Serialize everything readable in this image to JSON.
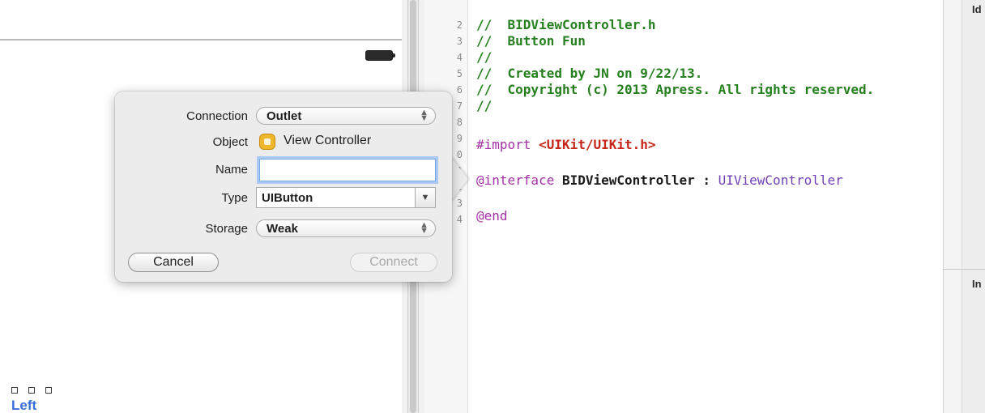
{
  "editor": {
    "line_numbers": [
      "2",
      "3",
      "4",
      "5",
      "6",
      "7",
      "8",
      "9",
      "0",
      "1",
      "2",
      "3",
      "4"
    ],
    "lines": [
      {
        "segments": [
          {
            "cls": "c-comment",
            "text": "//  BIDViewController.h"
          }
        ]
      },
      {
        "segments": [
          {
            "cls": "c-comment",
            "text": "//  Button Fun"
          }
        ]
      },
      {
        "segments": [
          {
            "cls": "c-comment",
            "text": "//"
          }
        ]
      },
      {
        "segments": [
          {
            "cls": "c-comment",
            "text": "//  Created by JN on 9/22/13."
          }
        ]
      },
      {
        "segments": [
          {
            "cls": "c-comment",
            "text": "//  Copyright (c) 2013 Apress. All rights reserved."
          }
        ]
      },
      {
        "segments": [
          {
            "cls": "c-comment",
            "text": "//"
          }
        ]
      },
      {
        "segments": []
      },
      {
        "segments": [
          {
            "cls": "c-kw",
            "text": "#import "
          },
          {
            "cls": "c-str",
            "text": "<UIKit/UIKit.h>"
          }
        ]
      },
      {
        "segments": []
      },
      {
        "segments": [
          {
            "cls": "c-kw",
            "text": "@interface "
          },
          {
            "cls": "c-plain",
            "text": "BIDViewController : "
          },
          {
            "cls": "c-type",
            "text": "UIViewController"
          }
        ]
      },
      {
        "segments": []
      },
      {
        "segments": [
          {
            "cls": "c-kw",
            "text": "@end"
          }
        ]
      }
    ]
  },
  "popover": {
    "connection_label": "Connection",
    "connection_value": "Outlet",
    "object_label": "Object",
    "object_value": "View Controller",
    "name_label": "Name",
    "name_value": "",
    "type_label": "Type",
    "type_value": "UIButton",
    "storage_label": "Storage",
    "storage_value": "Weak",
    "cancel_label": "Cancel",
    "connect_label": "Connect"
  },
  "canvas": {
    "left_label": "Left"
  },
  "inspector": {
    "top_label": "Id",
    "mid_label": "In"
  },
  "icons": {
    "battery": "battery-icon",
    "object": "view-controller-icon",
    "stepper": "up-down-stepper-icon",
    "dropdown": "triangle-down-icon"
  }
}
